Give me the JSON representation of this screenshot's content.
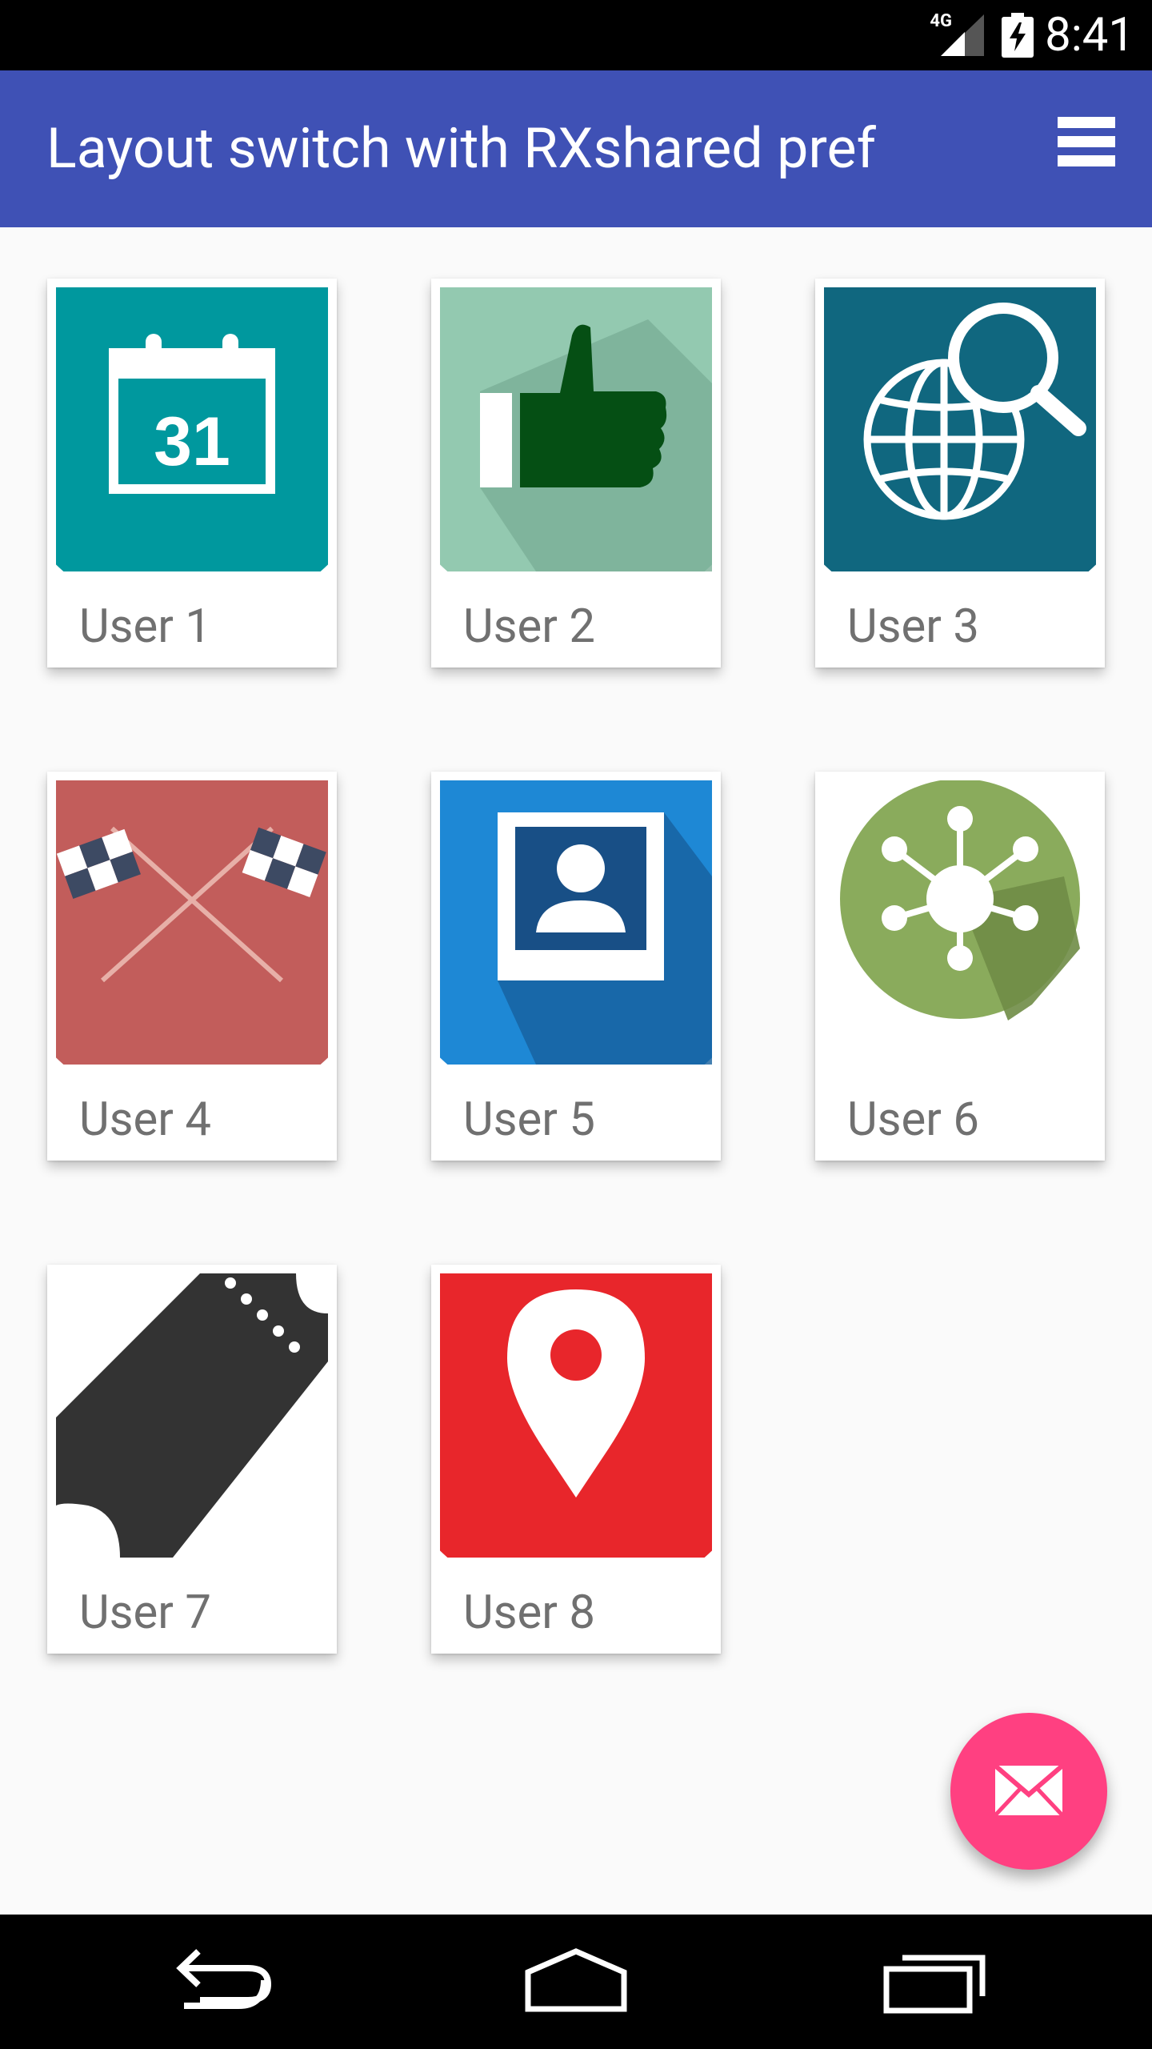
{
  "status_bar": {
    "network": "4G",
    "time": "8:41"
  },
  "app_bar": {
    "title": "Layout switch with RXshared pref",
    "menu_icon": "view-list-icon"
  },
  "cards": [
    {
      "label": "User 1",
      "icon": "calendar-icon",
      "color": "#00989e"
    },
    {
      "label": "User 2",
      "icon": "thumbs-up-icon",
      "color": "#93c9b0"
    },
    {
      "label": "User 3",
      "icon": "globe-search-icon",
      "color": "#10677f"
    },
    {
      "label": "User 4",
      "icon": "checkered-flags-icon",
      "color": "#c25d5b"
    },
    {
      "label": "User 5",
      "icon": "contact-photo-icon",
      "color": "#1e88d5"
    },
    {
      "label": "User 6",
      "icon": "network-hub-icon",
      "color": "#8aab5c"
    },
    {
      "label": "User 7",
      "icon": "ticket-icon",
      "color": "#333333"
    },
    {
      "label": "User 8",
      "icon": "map-pin-icon",
      "color": "#e8262b"
    }
  ],
  "fab": {
    "icon": "email-icon",
    "color": "#ff4081"
  },
  "nav_bar": {
    "back": "back-icon",
    "home": "home-icon",
    "recents": "recents-icon"
  },
  "colors": {
    "primary": "#3f51b5",
    "accent": "#ff4081",
    "background": "#fafafa"
  }
}
